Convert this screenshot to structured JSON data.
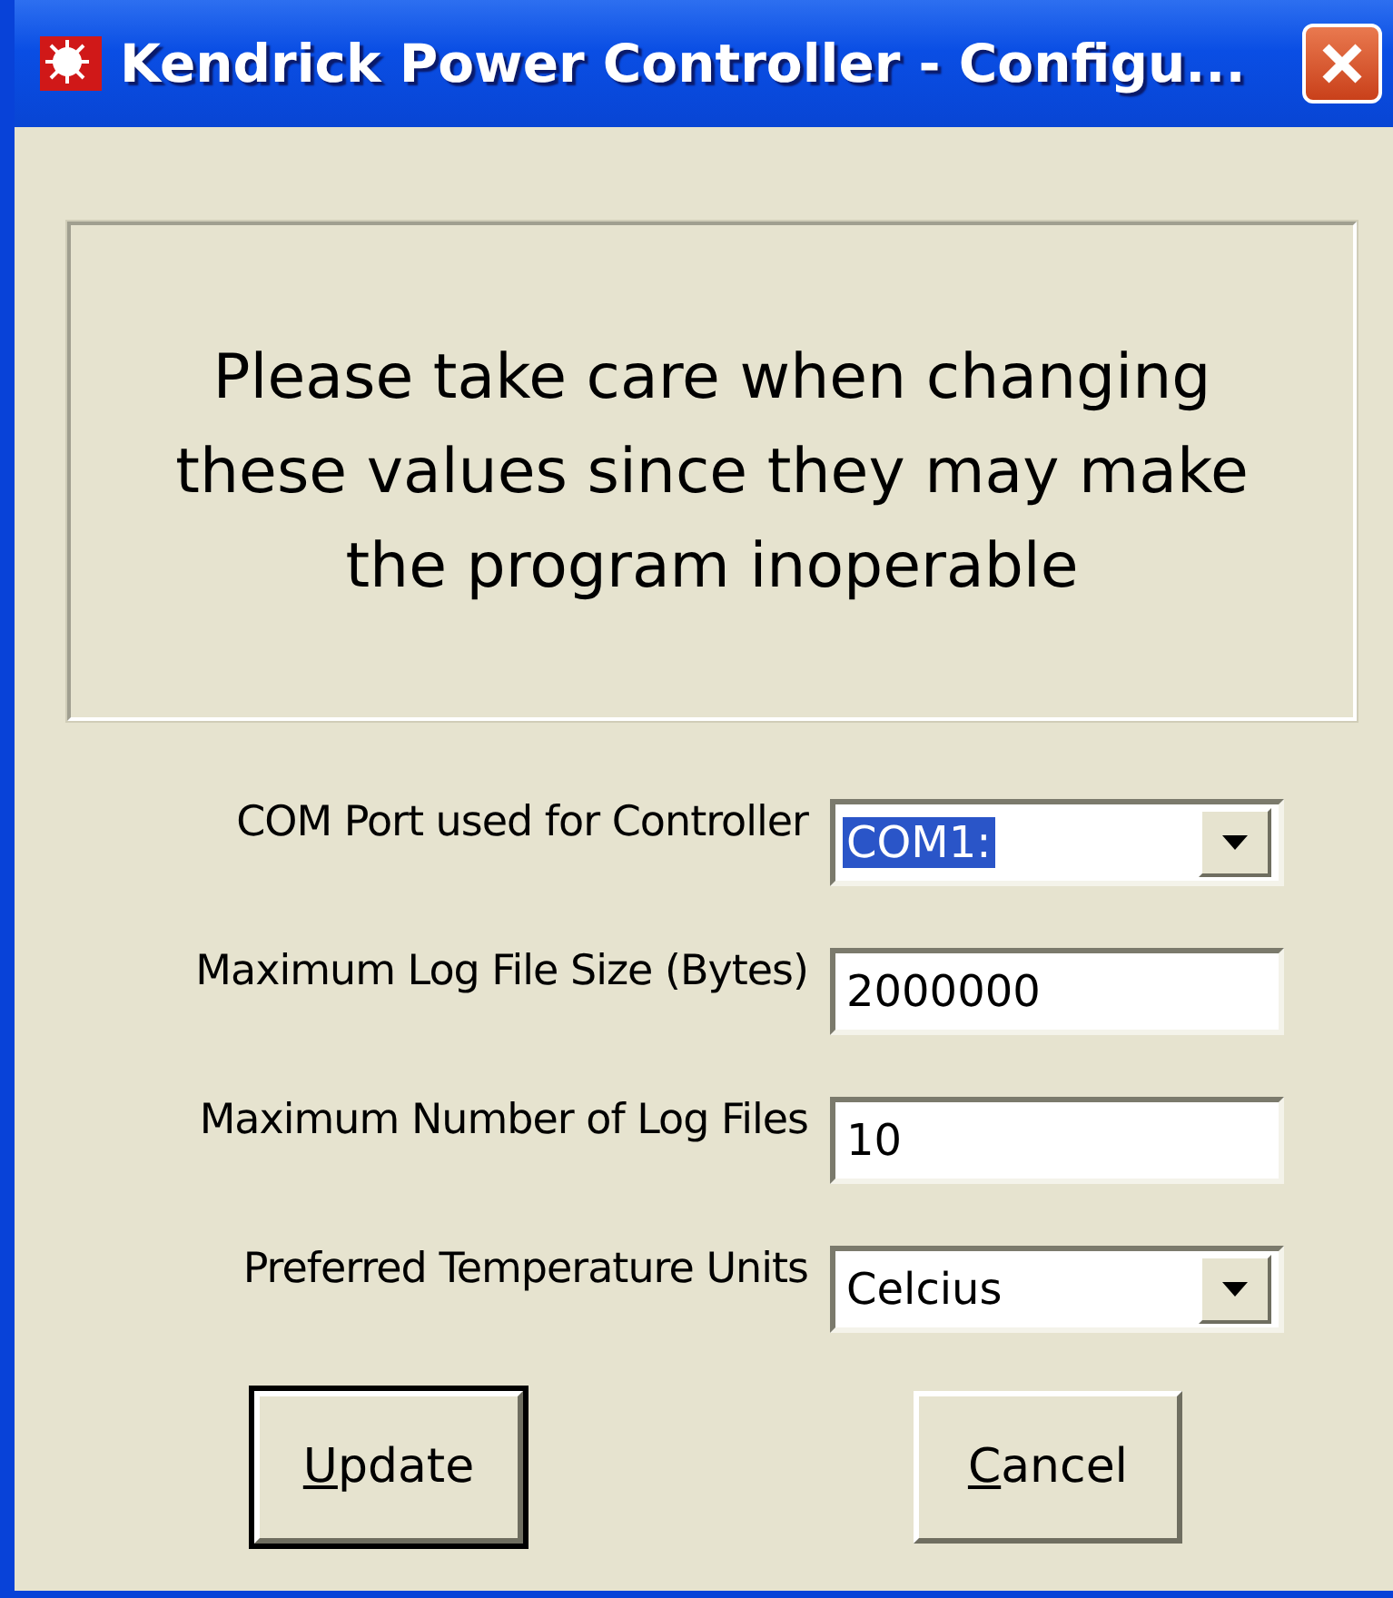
{
  "window": {
    "title": "Kendrick Power Controller - Configu..."
  },
  "warning": "Please take care when changing these values since they may make the program inoperable",
  "fields": [
    {
      "label": "COM Port used for Controller",
      "kind": "dropdown",
      "value": "COM1:",
      "highlighted": true
    },
    {
      "label": "Maximum Log File Size (Bytes)",
      "kind": "text",
      "value": "2000000",
      "highlighted": false
    },
    {
      "label": "Maximum Number of Log Files",
      "kind": "text",
      "value": "10",
      "highlighted": false
    },
    {
      "label": "Preferred Temperature Units",
      "kind": "dropdown",
      "value": "Celcius",
      "highlighted": false
    }
  ],
  "buttons": [
    {
      "label": "Update",
      "default": true,
      "first_letter_underlined": true
    },
    {
      "label": "Cancel",
      "default": false,
      "first_letter_underlined": true
    }
  ]
}
